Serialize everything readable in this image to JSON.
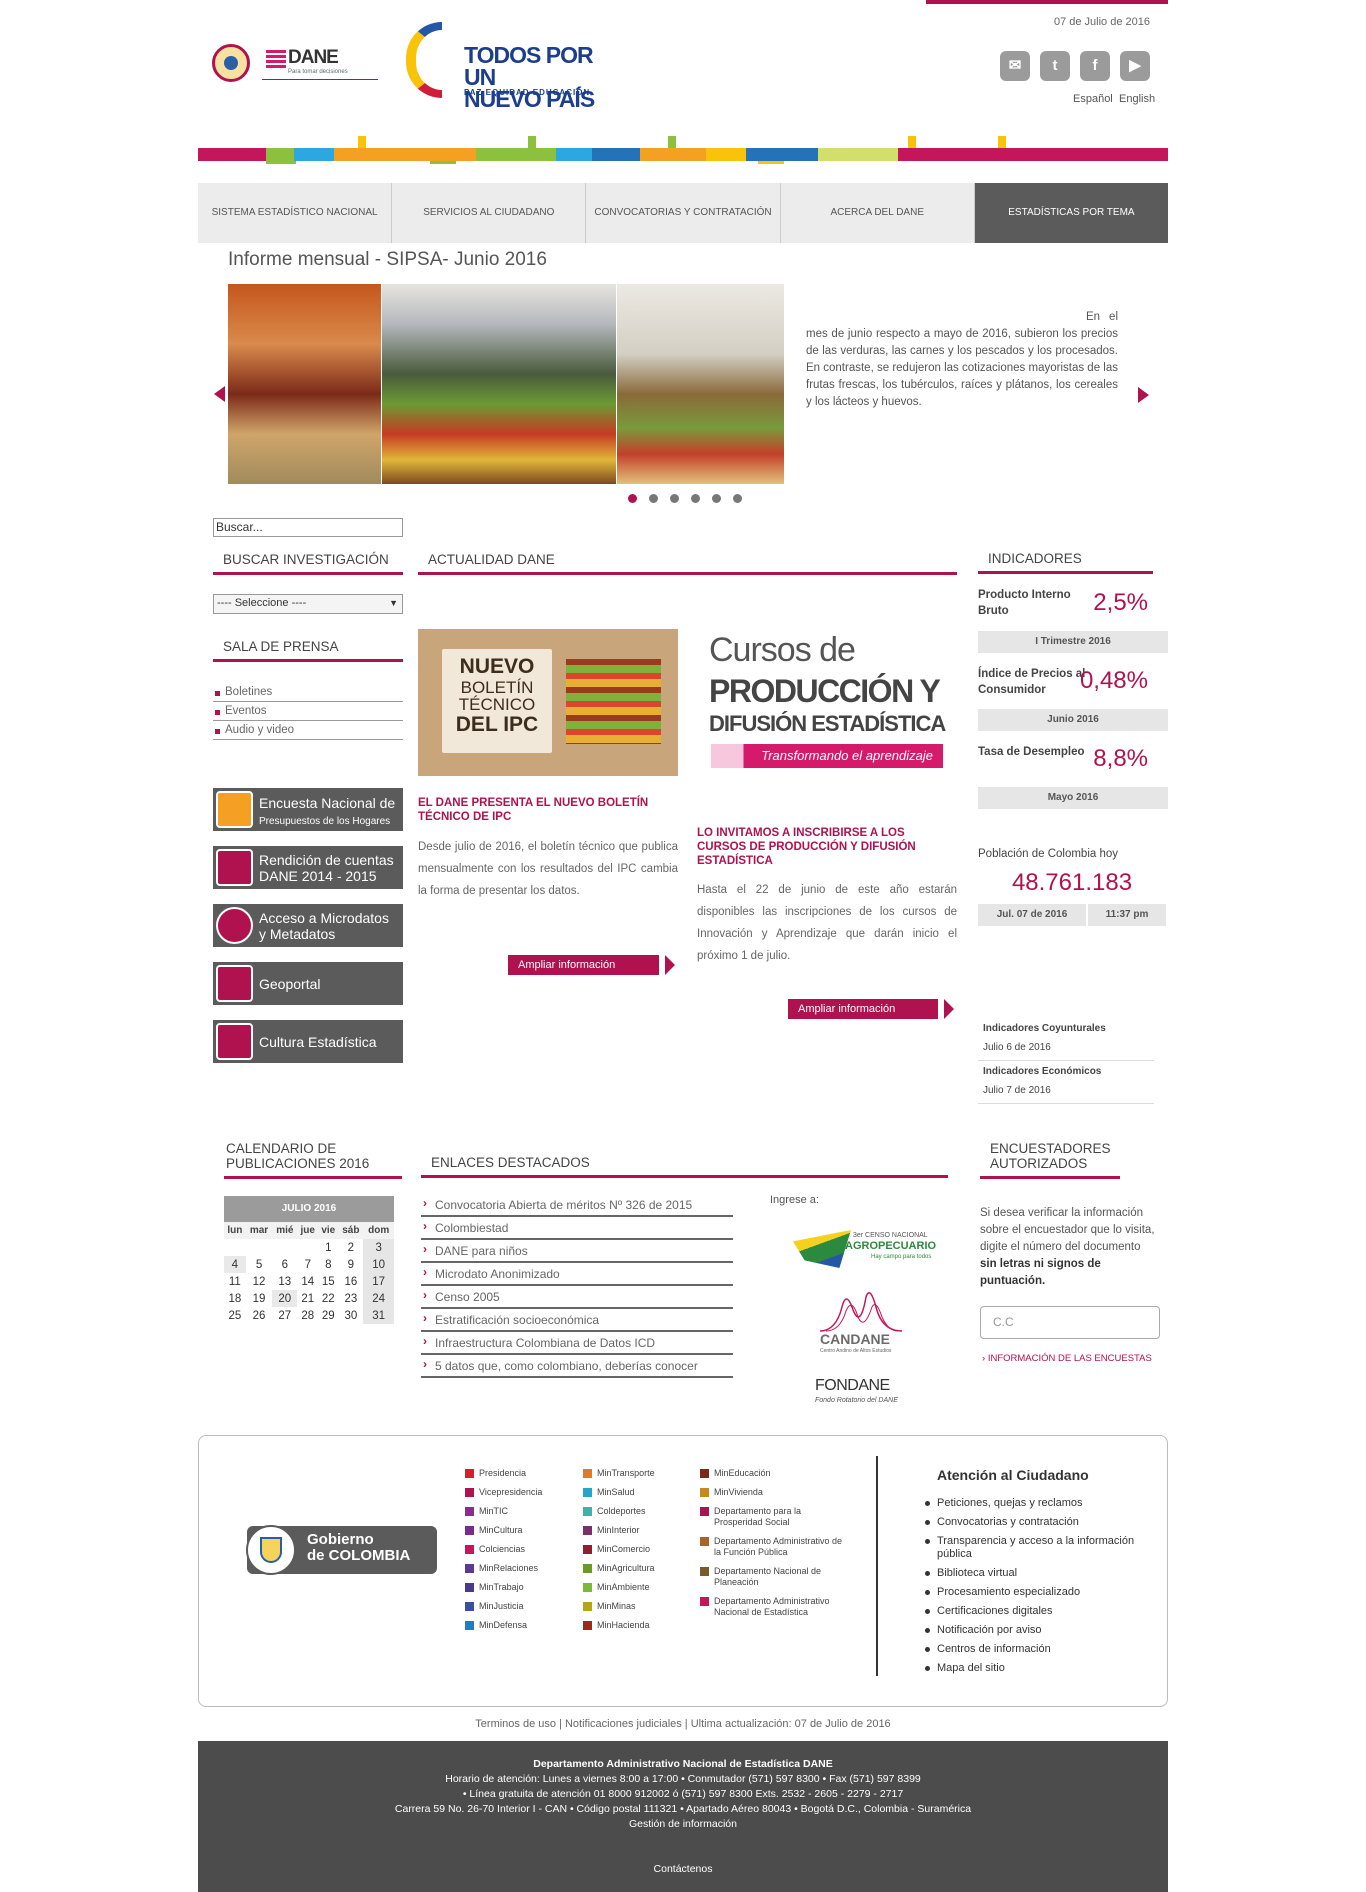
{
  "header": {
    "date": "07 de Julio de 2016",
    "social": [
      {
        "name": "mail-icon",
        "glyph": "✉"
      },
      {
        "name": "twitter-icon",
        "glyph": "t"
      },
      {
        "name": "facebook-icon",
        "glyph": "f"
      },
      {
        "name": "youtube-icon",
        "glyph": "▶"
      }
    ],
    "lang_es": "Español",
    "lang_en": "English",
    "logo_dane": "DANE",
    "logo_dane_tag": "Para tomar decisiones",
    "logo_tpun_1": "TODOS POR UN",
    "logo_tpun_2": "NUEVO PAÍS",
    "logo_tpun_3": "PAZ  EQUIDAD  EDUCACIÓN"
  },
  "nav": [
    "SISTEMA ESTADÍSTICO NACIONAL",
    "SERVICIOS AL CIUDADANO",
    "CONVOCATORIAS Y CONTRATACIÓN",
    "ACERCA DEL DANE",
    "ESTADÍSTICAS POR TEMA"
  ],
  "slider": {
    "title": "Informe mensual - SIPSA- Junio 2016",
    "text": "En el mes de junio respecto a mayo de 2016, subieron los precios de las verduras, las carnes y los pescados y los procesados. En contraste, se redujeron las cotizaciones mayoristas de las frutas frescas, los tubérculos, raíces y plátanos, los cereales y los lácteos y huevos."
  },
  "search": {
    "value": "Buscar..."
  },
  "left": {
    "buscar_title": "BUSCAR INVESTIGACIÓN",
    "select_value": "---- Seleccione ----",
    "sala_title": "SALA DE PRENSA",
    "press": [
      "Boletines",
      "Eventos",
      "Audio y video"
    ],
    "quick": [
      {
        "l1": "Encuesta Nacional de",
        "l2": "Presupuestos de los Hogares"
      },
      {
        "l1": "Rendición de cuentas",
        "l2": "DANE 2014 - 2015"
      },
      {
        "l1": "Acceso a Microdatos",
        "l2": "y Metadatos"
      },
      {
        "l1": "Geoportal",
        "l2": ""
      },
      {
        "l1": "Cultura Estadística",
        "l2": ""
      }
    ]
  },
  "news": {
    "title": "ACTUALIDAD DANE",
    "img1_l1": "NUEVO",
    "img1_l2": "BOLETÍN",
    "img1_l3": "TÉCNICO",
    "img1_l4": "DEL IPC",
    "img2_l1": "Cursos de",
    "img2_l2": "PRODUCCIÓN Y",
    "img2_l3": "DIFUSIÓN ESTADÍSTICA",
    "img2_l4": "Transformando el aprendizaje",
    "n1_title": "EL DANE PRESENTA EL NUEVO BOLETÍN TÉCNICO DE IPC",
    "n1_text": "Desde julio de 2016, el boletín técnico que publica mensualmente con los resultados del IPC cambia la forma de presentar los datos.",
    "n2_title": "LO INVITAMOS A INSCRIBIRSE A LOS CURSOS DE PRODUCCIÓN Y DIFUSIÓN ESTADÍSTICA",
    "n2_text": "Hasta el 22 de junio de este año estarán disponibles las inscripciones de los cursos de Innovación y Aprendizaje que darán inicio el próximo 1 de julio.",
    "more": "Ampliar información"
  },
  "indicators": {
    "title": "INDICADORES",
    "items": [
      {
        "label": "Producto Interno Bruto",
        "value": "2,5%",
        "period": "I Trimestre 2016"
      },
      {
        "label": "Índice de Precios al Consumidor",
        "value": "0,48%",
        "period": "Junio 2016"
      },
      {
        "label": "Tasa de Desempleo",
        "value": "8,8%",
        "period": "Mayo  2016"
      }
    ],
    "pop_label": "Población de Colombia hoy",
    "pop_value": "48.761.183",
    "pop_date": "Jul. 07 de 2016",
    "pop_time": "11:37 pm",
    "pubs": [
      {
        "title": "Indicadores Coyunturales",
        "date": "Julio 6 de 2016"
      },
      {
        "title": "Indicadores Económicos",
        "date": "Julio 7 de 2016"
      }
    ]
  },
  "calendar": {
    "title": "CALENDARIO DE PUBLICACIONES 2016",
    "month": "JULIO 2016",
    "days": [
      "lun",
      "mar",
      "mié",
      "jue",
      "vie",
      "sáb",
      "dom"
    ],
    "weeks": [
      [
        "",
        "",
        "",
        "",
        "1",
        "2",
        "3"
      ],
      [
        "4",
        "5",
        "6",
        "7",
        "8",
        "9",
        "10"
      ],
      [
        "11",
        "12",
        "13",
        "14",
        "15",
        "16",
        "17"
      ],
      [
        "18",
        "19",
        "20",
        "21",
        "22",
        "23",
        "24"
      ],
      [
        "25",
        "26",
        "27",
        "28",
        "29",
        "30",
        "31"
      ]
    ]
  },
  "links": {
    "title": "ENLACES DESTACADOS",
    "items": [
      "Convocatoria Abierta de méritos  Nº 326 de 2015",
      "Colombiestad",
      "DANE para niños",
      "Microdato Anonimizado",
      "Censo 2005",
      "Estratificación socioeconómica",
      "Infraestructura Colombiana de Datos ICD",
      "5 datos que, como colombiano, deberías conocer"
    ],
    "ingrese": "Ingrese a:",
    "logo1_l1": "3er CENSO NACIONAL",
    "logo1_l2": "AGROPECUARIO",
    "logo1_l3": "Hay campo para todos",
    "logo2": "CANDANE",
    "logo2_sub": "Centro Andino de Altos Estudios",
    "logo3": "FONDANE",
    "logo3_sub": "Fondo Rotatorio del DANE"
  },
  "encuestadores": {
    "title": "ENCUESTADORES AUTORIZADOS",
    "text": "Si desea verificar la información sobre el encuestador que lo visita, digite el número del documento",
    "bold": "sin letras ni signos de puntuación.",
    "placeholder": "C.C",
    "link": "INFORMACIÓN DE LAS ENCUESTAS"
  },
  "footer": {
    "gob_l1": "Gobierno",
    "gob_l2": "de COLOMBIA",
    "col1": [
      {
        "t": "Presidencia",
        "c": "#d4202c"
      },
      {
        "t": "Vicepresidencia",
        "c": "#b0124f"
      },
      {
        "t": "MinTIC",
        "c": "#8e2a8b"
      },
      {
        "t": "MinCultura",
        "c": "#7a2c8e"
      },
      {
        "t": "Colciencias",
        "c": "#c4175b"
      },
      {
        "t": "MinRelaciones",
        "c": "#5c3a93"
      },
      {
        "t": "MinTrabajo",
        "c": "#4a3a8c"
      },
      {
        "t": "MinJusticia",
        "c": "#3b4fa2"
      },
      {
        "t": "MinDefensa",
        "c": "#1b7fc3"
      }
    ],
    "col2": [
      {
        "t": "MinTransporte",
        "c": "#e07a2a"
      },
      {
        "t": "MinSalud",
        "c": "#27a4c7"
      },
      {
        "t": "Coldeportes",
        "c": "#3bb3a8"
      },
      {
        "t": "MinInterior",
        "c": "#7a2e6a"
      },
      {
        "t": "MinComercio",
        "c": "#8a2230"
      },
      {
        "t": "MinAgricultura",
        "c": "#6a9a2c"
      },
      {
        "t": "MinAmbiente",
        "c": "#7bb93a"
      },
      {
        "t": "MinMinas",
        "c": "#b5a41d"
      },
      {
        "t": "MinHacienda",
        "c": "#9a2a1c"
      }
    ],
    "col3": [
      {
        "t": "MinEducación",
        "c": "#7a2a1a"
      },
      {
        "t": "MinVivienda",
        "c": "#c48a1a"
      },
      {
        "t": "Departamento para la Prosperidad Social",
        "c": "#b0124f"
      },
      {
        "t": "Departamento Administrativo de la Función Pública",
        "c": "#a8652a"
      },
      {
        "t": "Departamento Nacional de Planeación",
        "c": "#7a5a2a"
      },
      {
        "t": "Departamento Administrativo Nacional de Estadística",
        "c": "#c4175b"
      }
    ],
    "att_title": "Atención al Ciudadano",
    "att": [
      "Peticiones, quejas y reclamos",
      "Convocatorias y contratación",
      "Transparencia y acceso a la información pública",
      "Biblioteca virtual",
      "Procesamiento especializado",
      "Certificaciones digitales",
      "Notificación por aviso",
      "Centros de información",
      "Mapa del sitio"
    ],
    "terms": "Terminos de uso | Notificaciones judiciales | Ultima actualización: 07 de Julio de 2016",
    "b1": "Departamento Administrativo Nacional de Estadística DANE",
    "b2": "Horario de atención: Lunes a viernes 8:00 a 17:00 • Conmutador (571) 597 8300 • Fax (571) 597 8399",
    "b3": "• Línea gratuita de atención 01 8000 912002 ó (571) 597 8300 Exts. 2532 - 2605 - 2279 - 2717",
    "b4": "Carrera 59 No. 26-70 Interior I - CAN • Código postal 111321 • Apartado Aéreo 80043 • Bogotá D.C., Colombia - Suramérica",
    "b5": "Gestión de información",
    "contact": "Contáctenos"
  }
}
